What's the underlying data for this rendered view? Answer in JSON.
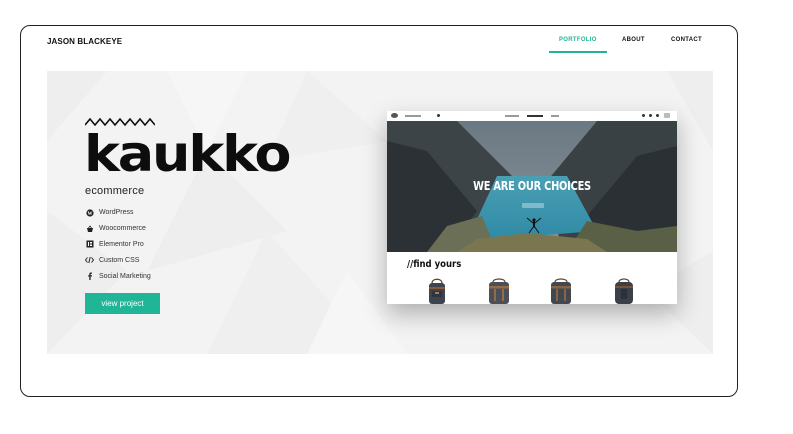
{
  "header": {
    "brand": "JASON BLACKEYE",
    "nav": [
      {
        "label": "PORTFOLIO",
        "active": true
      },
      {
        "label": "ABOUT",
        "active": false
      },
      {
        "label": "CONTACT",
        "active": false
      }
    ]
  },
  "project": {
    "logo": "kaukko",
    "subtitle": "ecommerce",
    "tech": [
      {
        "label": "WordPress",
        "icon": "wordpress-icon"
      },
      {
        "label": "Woocommerce",
        "icon": "basket-icon"
      },
      {
        "label": "Elementor Pro",
        "icon": "elementor-icon"
      },
      {
        "label": "Custom CSS",
        "icon": "code-icon"
      },
      {
        "label": "Social Marketing",
        "icon": "facebook-icon"
      }
    ],
    "cta_label": "view project"
  },
  "preview": {
    "hero_heading": "WE ARE OUR CHOICES",
    "find_heading": "//find yours"
  },
  "colors": {
    "accent": "#1fb596",
    "hero_bg": "#f3f3f3",
    "text": "#111111"
  }
}
